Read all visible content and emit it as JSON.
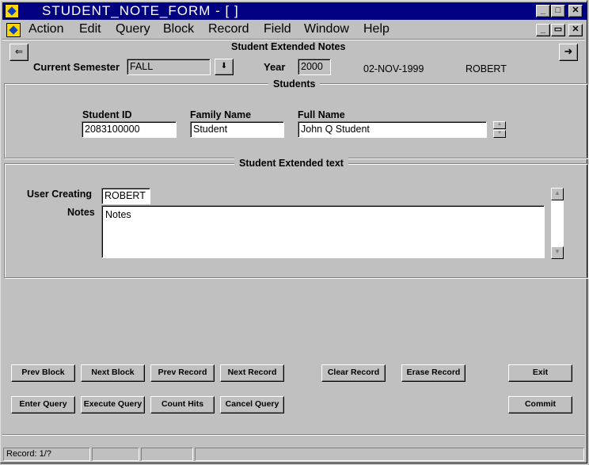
{
  "window": {
    "title": "STUDENT_NOTE_FORM - [ ]",
    "minimize_glyph": "_",
    "maximize_glyph": "□",
    "close_glyph": "✕",
    "restore_glyph": "▭"
  },
  "menu": {
    "items": [
      {
        "label": "Action",
        "icon": "menu"
      },
      {
        "label": "Edit"
      },
      {
        "label": "Query"
      },
      {
        "label": "Block"
      },
      {
        "label": "Record"
      },
      {
        "label": "Field"
      },
      {
        "label": "Window"
      },
      {
        "label": "Help"
      }
    ]
  },
  "header": {
    "form_title": "Student Extended Notes",
    "back_glyph": "⇐",
    "forward_glyph": "➜",
    "semester_label": "Current Semester",
    "semester_value": "FALL",
    "dropdown_glyph": "⬇",
    "year_label": "Year",
    "year_value": "2000",
    "date": "02-NOV-1999",
    "user": "ROBERT"
  },
  "students": {
    "title": "Students",
    "student_id_label": "Student ID",
    "student_id_value": "2083100000",
    "family_name_label": "Family Name",
    "family_name_value": "Student",
    "full_name_label": "Full Name",
    "full_name_value": "John Q Student"
  },
  "extended": {
    "title": "Student Extended text",
    "user_creating_label": "User Creating",
    "user_creating_value": "ROBERT",
    "notes_label": "Notes",
    "notes_value": "Notes"
  },
  "buttons": {
    "prev_block": "Prev Block",
    "next_block": "Next Block",
    "prev_record": "Prev Record",
    "next_record": "Next Record",
    "clear_record": "Clear Record",
    "erase_record": "Erase Record",
    "exit": "Exit",
    "enter_query": "Enter Query",
    "execute_query": "Execute Query",
    "count_hits": "Count Hits",
    "cancel_query": "Cancel Query",
    "commit": "Commit"
  },
  "status": {
    "record": "Record: 1/?"
  },
  "colors": {
    "titlebar": "#000080",
    "face": "#c0c0c0"
  }
}
